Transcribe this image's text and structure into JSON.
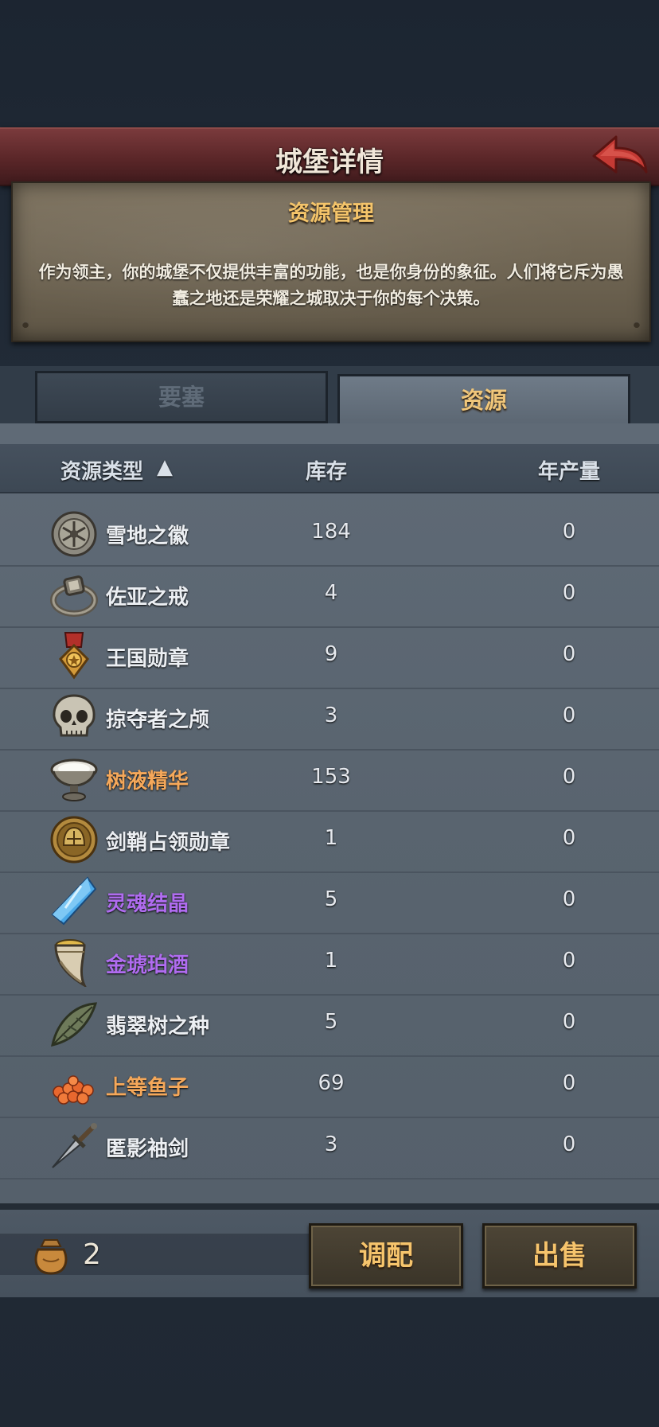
{
  "header": {
    "title": "城堡详情"
  },
  "info": {
    "subtitle": "资源管理",
    "description": "作为领主，你的城堡不仅提供丰富的功能，也是你身份的象征。人们将它斥为愚蠢之地还是荣耀之城取决于你的每个决策。"
  },
  "tabs": [
    {
      "label": "要塞",
      "active": false
    },
    {
      "label": "资源",
      "active": true
    }
  ],
  "table": {
    "columns": {
      "type": "资源类型",
      "stock": "库存",
      "yearly": "年产量"
    },
    "rows": [
      {
        "name": "雪地之徽",
        "stock": "184",
        "yearly": "0",
        "icon": "snow-emblem-icon",
        "color": "white"
      },
      {
        "name": "佐亚之戒",
        "stock": "4",
        "yearly": "0",
        "icon": "ring-icon",
        "color": "white"
      },
      {
        "name": "王国勋章",
        "stock": "9",
        "yearly": "0",
        "icon": "medal-icon",
        "color": "white"
      },
      {
        "name": "掠夺者之颅",
        "stock": "3",
        "yearly": "0",
        "icon": "skull-icon",
        "color": "white"
      },
      {
        "name": "树液精华",
        "stock": "153",
        "yearly": "0",
        "icon": "sap-bowl-icon",
        "color": "orange"
      },
      {
        "name": "剑鞘占领勋章",
        "stock": "1",
        "yearly": "0",
        "icon": "helmet-medal-icon",
        "color": "white"
      },
      {
        "name": "灵魂结晶",
        "stock": "5",
        "yearly": "0",
        "icon": "crystal-icon",
        "color": "purple"
      },
      {
        "name": "金琥珀酒",
        "stock": "1",
        "yearly": "0",
        "icon": "horn-cup-icon",
        "color": "purple"
      },
      {
        "name": "翡翠树之种",
        "stock": "5",
        "yearly": "0",
        "icon": "leaf-seed-icon",
        "color": "white"
      },
      {
        "name": "上等鱼子",
        "stock": "69",
        "yearly": "0",
        "icon": "roe-icon",
        "color": "orange"
      },
      {
        "name": "匿影袖剑",
        "stock": "3",
        "yearly": "0",
        "icon": "dagger-icon",
        "color": "white"
      }
    ]
  },
  "footer": {
    "gold_icon": "gold-sack-icon",
    "gold_value": "2",
    "allocate_label": "调配",
    "sell_label": "出售"
  },
  "colors": {
    "orange_quality": "#f5a85a",
    "purple_quality": "#b06cf0",
    "tab_active_text": "#f0c67a"
  }
}
